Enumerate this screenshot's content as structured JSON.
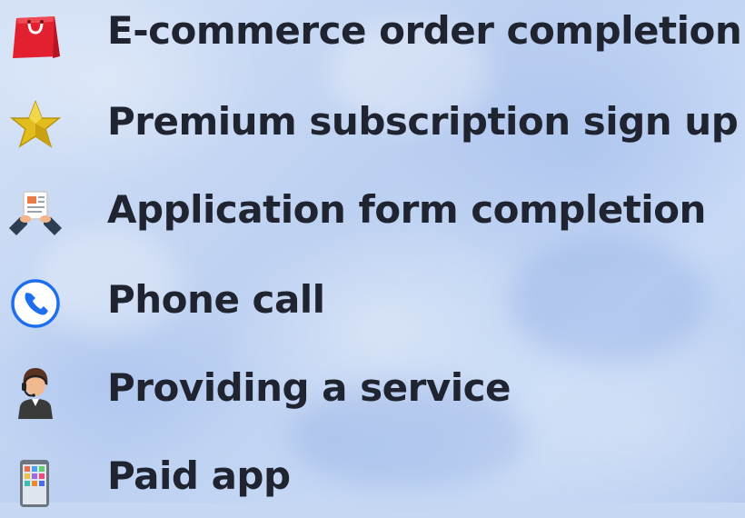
{
  "items": [
    {
      "label": "E-commerce order completion",
      "icon": "shopping-bag-icon",
      "color": "#e3202f"
    },
    {
      "label": "Premium subscription sign up",
      "icon": "star-icon",
      "color": "#e8c422"
    },
    {
      "label": "Application form completion",
      "icon": "form-handshake-icon",
      "color": "#2c3e50"
    },
    {
      "label": "Phone call",
      "icon": "phone-icon",
      "color": "#1e6ff0"
    },
    {
      "label": "Providing a service",
      "icon": "support-agent-icon",
      "color": "#2f2f2f"
    },
    {
      "label": "Paid app",
      "icon": "mobile-app-icon",
      "color": "#6c7480"
    }
  ]
}
